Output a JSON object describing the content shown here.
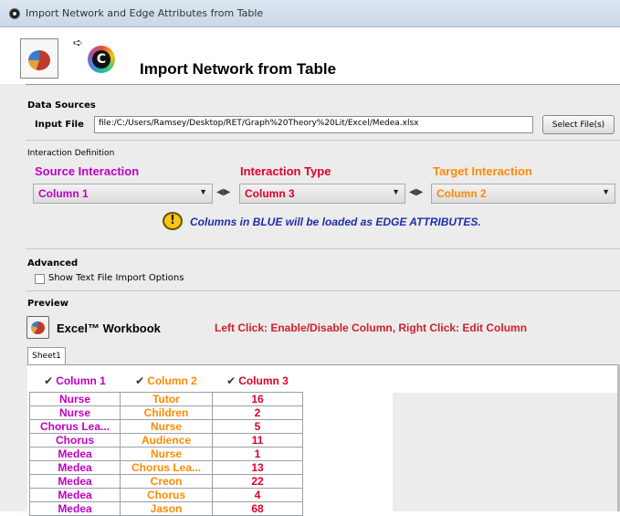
{
  "window": {
    "title": "Import Network and Edge Attributes from Table"
  },
  "header": {
    "title": "Import Network from Table"
  },
  "data_sources": {
    "group_label": "Data Sources",
    "input_file_label": "Input File",
    "input_file_value": "file:/C:/Users/Ramsey/Desktop/RET/Graph%20Theory%20Lit/Excel/Medea.xlsx",
    "select_button": "Select File(s)"
  },
  "interaction": {
    "group_label": "Interaction Definition",
    "source_label": "Source Interaction",
    "type_label": "Interaction Type",
    "target_label": "Target Interaction",
    "source_value": "Column 1",
    "type_value": "Column 3",
    "target_value": "Column 2",
    "note": "Columns in BLUE will be loaded as EDGE ATTRIBUTES."
  },
  "advanced": {
    "group_label": "Advanced",
    "checkbox_label": "Show Text File Import Options"
  },
  "preview": {
    "group_label": "Preview",
    "workbook_label": "Excel™ Workbook",
    "hint": "Left Click: Enable/Disable Column, Right Click: Edit Column",
    "sheet_tab": "Sheet1",
    "columns": [
      "Column 1",
      "Column 2",
      "Column 3"
    ],
    "rows": [
      [
        "Nurse",
        "Tutor",
        "16"
      ],
      [
        "Nurse",
        "Children",
        "2"
      ],
      [
        "Chorus Lea...",
        "Nurse",
        "5"
      ],
      [
        "Chorus",
        "Audience",
        "11"
      ],
      [
        "Medea",
        "Nurse",
        "1"
      ],
      [
        "Medea",
        "Chorus Lea...",
        "13"
      ],
      [
        "Medea",
        "Creon",
        "22"
      ],
      [
        "Medea",
        "Chorus",
        "4"
      ],
      [
        "Medea",
        "Jason",
        "68"
      ]
    ]
  },
  "colors": {
    "source": "#c000c0",
    "type": "#e0002a",
    "target": "#ff8a00",
    "note": "#1e2fa8",
    "hint": "#d0202c"
  },
  "icons": {
    "title": "cytoscape-logo-icon",
    "header_doc": "table-document-icon",
    "header_arrow": "arrow-right-icon",
    "header_logo": "cytoscape-color-logo-icon",
    "warning": "warning-icon",
    "excel": "excel-workbook-icon",
    "check": "checkmark-icon",
    "swap": "swap-arrows-icon"
  }
}
